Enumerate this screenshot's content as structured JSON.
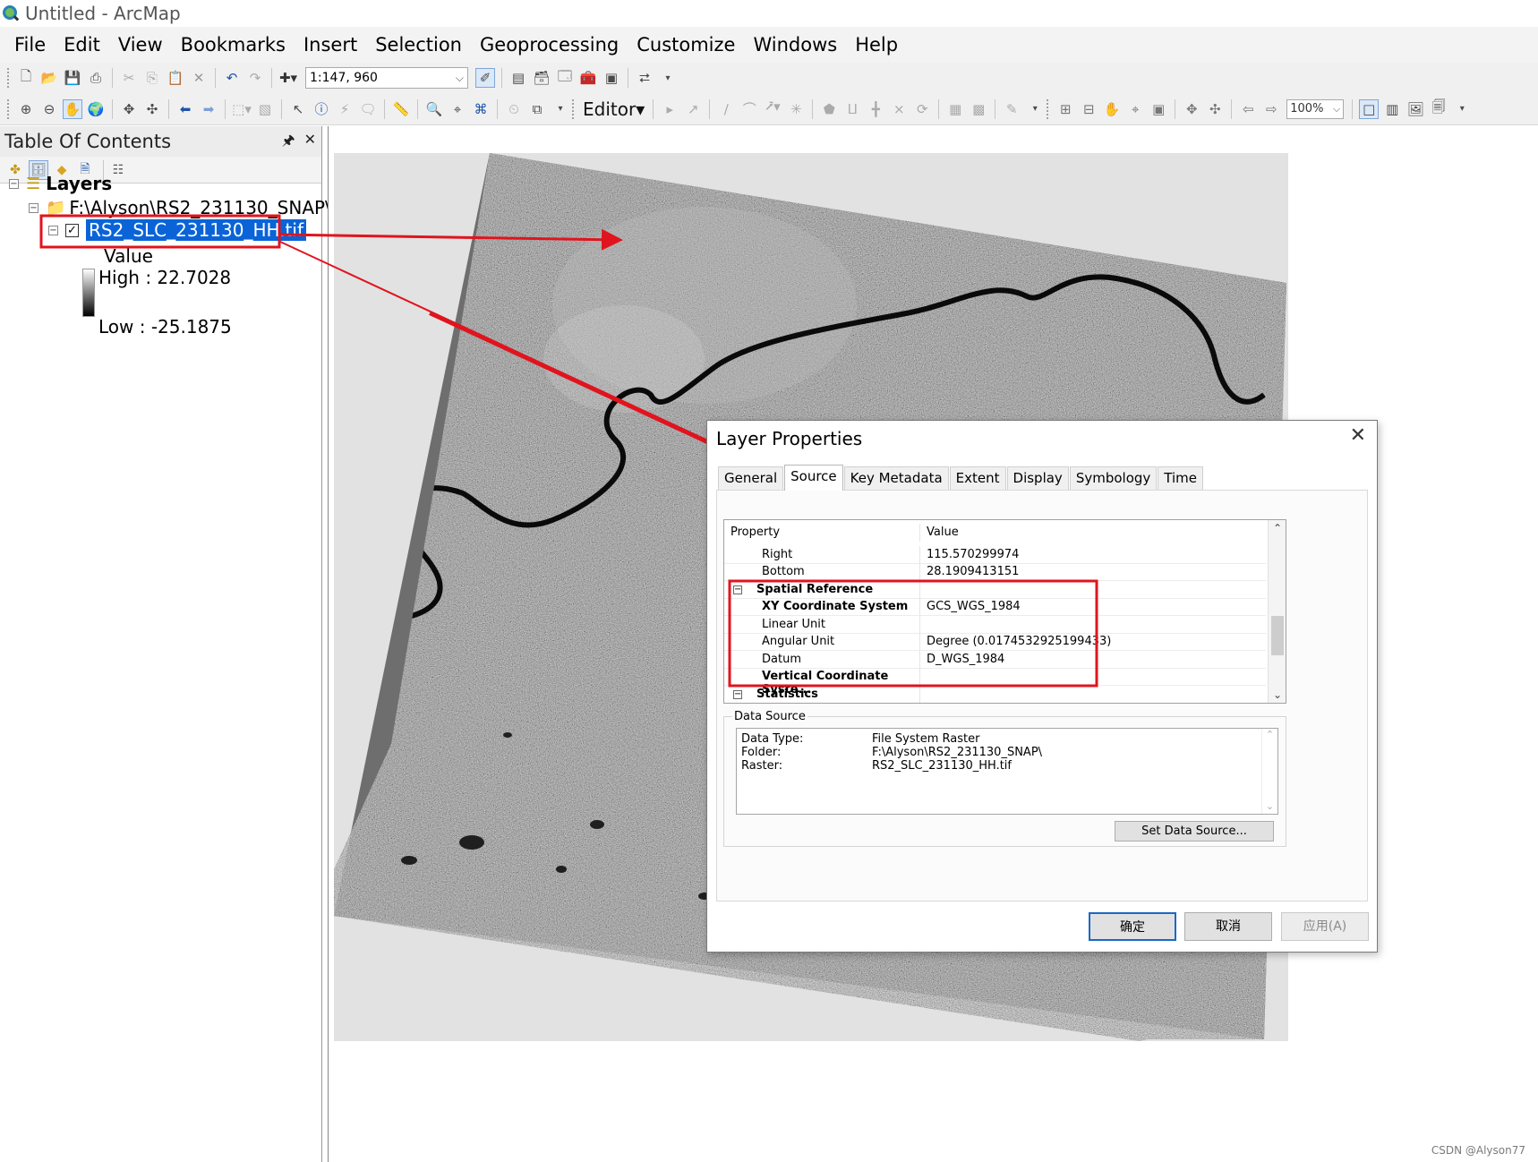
{
  "window": {
    "title": "Untitled - ArcMap"
  },
  "menu": [
    "File",
    "Edit",
    "View",
    "Bookmarks",
    "Insert",
    "Selection",
    "Geoprocessing",
    "Customize",
    "Windows",
    "Help"
  ],
  "toolbar": {
    "scale": "1:147, 960",
    "editor_label": "Editor",
    "zoom_level": "100%"
  },
  "toc": {
    "title": "Table Of Contents",
    "root": "Layers",
    "folder": "F:\\Alyson\\RS2_231130_SNAP\\",
    "layer": "RS2_SLC_231130_HH.tif",
    "layer_checked": true,
    "legend_title": "Value",
    "high": "High : 22.7028",
    "low": "Low : -25.1875"
  },
  "dialog": {
    "title": "Layer Properties",
    "tabs": [
      "General",
      "Source",
      "Key Metadata",
      "Extent",
      "Display",
      "Symbology",
      "Time"
    ],
    "active_tab": "Source",
    "grid_header": {
      "property": "Property",
      "value": "Value"
    },
    "rows": [
      {
        "property": "Right",
        "value": "115.570299974"
      },
      {
        "property": "Bottom",
        "value": "28.1909413151"
      },
      {
        "property": "Spatial Reference",
        "value": ""
      },
      {
        "property": "XY Coordinate System",
        "value": "GCS_WGS_1984"
      },
      {
        "property": "Linear Unit",
        "value": ""
      },
      {
        "property": "Angular Unit",
        "value": "Degree (0.0174532925199433)"
      },
      {
        "property": "Datum",
        "value": "D_WGS_1984"
      },
      {
        "property": "Vertical Coordinate Syste...",
        "value": ""
      },
      {
        "property": "Statistics",
        "value": ""
      }
    ],
    "data_source": {
      "label": "Data Source",
      "data_type_key": "Data Type:",
      "data_type": "File System Raster",
      "folder_key": "Folder:",
      "folder": "F:\\Alyson\\RS2_231130_SNAP\\",
      "raster_key": "Raster:",
      "raster": "RS2_SLC_231130_HH.tif"
    },
    "set_data_source": "Set Data Source...",
    "ok": "确定",
    "cancel": "取消",
    "apply": "应用(A)"
  },
  "annotation_color": "#e0141e",
  "watermark": "CSDN @Alyson77"
}
